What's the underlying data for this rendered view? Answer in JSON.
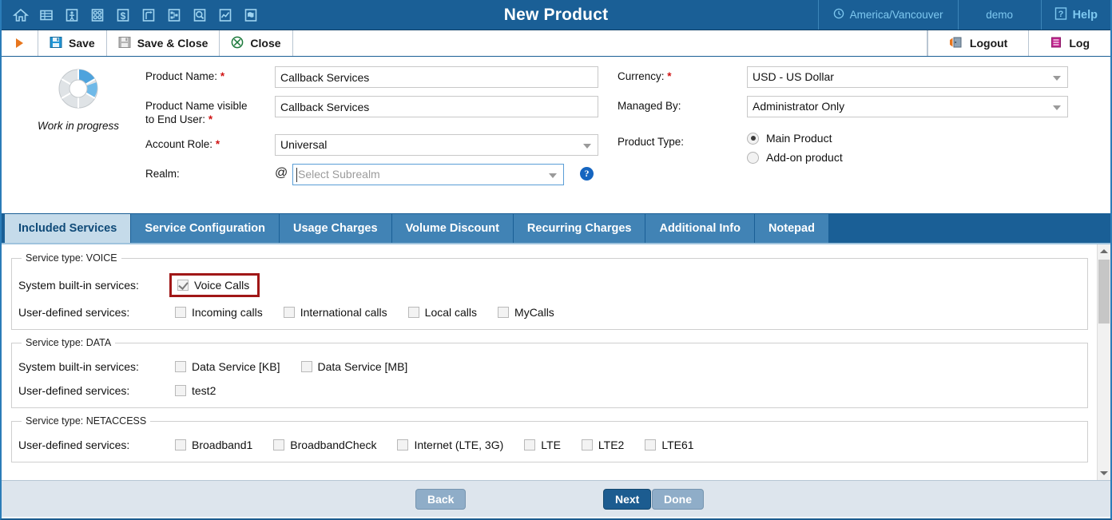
{
  "header": {
    "title": "New Product",
    "nav_icons": [
      {
        "name": "home-icon"
      },
      {
        "name": "list-icon"
      },
      {
        "name": "person-icon"
      },
      {
        "name": "grid-icon"
      },
      {
        "name": "dollar-icon"
      },
      {
        "name": "routing-icon"
      },
      {
        "name": "nodes-icon"
      },
      {
        "name": "search-icon"
      },
      {
        "name": "chart-icon"
      },
      {
        "name": "globe-icon"
      }
    ],
    "timezone": "America/Vancouver",
    "timezone_icon": "clock-icon",
    "user": "demo",
    "help": "Help",
    "help_icon": "question-icon"
  },
  "toolbar": {
    "run_icon": "play-icon",
    "save_label": "Save",
    "save_icon": "save-icon",
    "save_close_label": "Save & Close",
    "save_close_icon": "save-disabled-icon",
    "close_label": "Close",
    "close_icon": "close-icon",
    "logout_label": "Logout",
    "logout_icon": "logout-icon",
    "log_label": "Log",
    "log_icon": "log-icon"
  },
  "status": {
    "icon": "work-in-progress-donut-icon",
    "label": "Work in progress"
  },
  "form": {
    "product_name": {
      "label": "Product Name:",
      "required": "*",
      "value": "Callback Services"
    },
    "product_name_end_user": {
      "label_line1": "Product Name visible",
      "label_line2": "to End User:",
      "required": "*",
      "value": "Callback Services"
    },
    "account_role": {
      "label": "Account Role:",
      "required": "*",
      "value": "Universal"
    },
    "realm": {
      "label": "Realm:",
      "at": "@",
      "placeholder": "Select Subrealm",
      "value": "",
      "help_icon": "help-circle-icon"
    },
    "currency": {
      "label": "Currency:",
      "required": "*",
      "value": "USD - US Dollar"
    },
    "managed_by": {
      "label": "Managed By:",
      "value": "Administrator Only"
    },
    "product_type": {
      "label": "Product Type:",
      "options": [
        {
          "label": "Main Product",
          "selected": true
        },
        {
          "label": "Add-on product",
          "selected": false
        }
      ]
    }
  },
  "tabs": [
    {
      "label": "Included Services",
      "active": true
    },
    {
      "label": "Service Configuration",
      "active": false
    },
    {
      "label": "Usage Charges",
      "active": false
    },
    {
      "label": "Volume Discount",
      "active": false
    },
    {
      "label": "Recurring Charges",
      "active": false
    },
    {
      "label": "Additional Info",
      "active": false
    },
    {
      "label": "Notepad",
      "active": false
    }
  ],
  "service_groups": [
    {
      "legend": "Service type: VOICE",
      "rows": [
        {
          "label": "System built-in services:",
          "highlighted": true,
          "items": [
            {
              "label": "Voice Calls",
              "checked": true
            }
          ]
        },
        {
          "label": "User-defined services:",
          "highlighted": false,
          "items": [
            {
              "label": "Incoming calls",
              "checked": false
            },
            {
              "label": "International calls",
              "checked": false
            },
            {
              "label": "Local calls",
              "checked": false
            },
            {
              "label": "MyCalls",
              "checked": false
            }
          ]
        }
      ]
    },
    {
      "legend": "Service type: DATA",
      "rows": [
        {
          "label": "System built-in services:",
          "highlighted": false,
          "items": [
            {
              "label": "Data Service [KB]",
              "checked": false
            },
            {
              "label": "Data Service [MB]",
              "checked": false
            }
          ]
        },
        {
          "label": "User-defined services:",
          "highlighted": false,
          "items": [
            {
              "label": "test2",
              "checked": false
            }
          ]
        }
      ]
    },
    {
      "legend": "Service type: NETACCESS",
      "rows": [
        {
          "label": "User-defined services:",
          "highlighted": false,
          "items": [
            {
              "label": "Broadband1",
              "checked": false
            },
            {
              "label": "BroadbandCheck",
              "checked": false
            },
            {
              "label": "Internet (LTE, 3G)",
              "checked": false
            },
            {
              "label": "LTE",
              "checked": false
            },
            {
              "label": "LTE2",
              "checked": false
            },
            {
              "label": "LTE61",
              "checked": false
            }
          ]
        }
      ]
    }
  ],
  "footer": {
    "back": "Back",
    "next": "Next",
    "done": "Done"
  },
  "scrollbar": {
    "up_icon": "chevron-up-icon",
    "down_icon": "chevron-down-icon"
  },
  "colors": {
    "header_blue": "#1a5f96",
    "tab_blue": "#4183b5",
    "tab_active": "#c5dbea",
    "accent_orange": "#e8761d",
    "required_red": "#d01414",
    "highlight_red": "#a01717",
    "primary_button": "#1c5c90"
  }
}
